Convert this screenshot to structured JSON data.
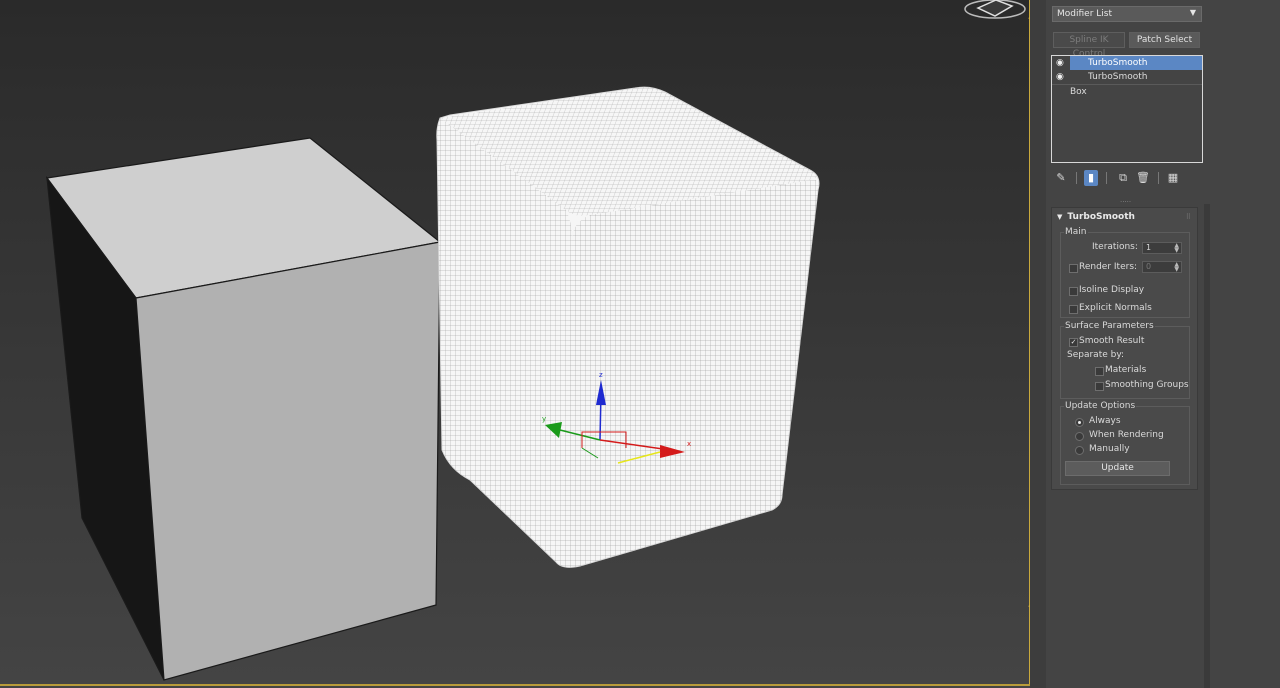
{
  "command_panel": {
    "modifier_list_label": "Modifier List",
    "buttons": {
      "spline_ik": "Spline IK Control",
      "patch_select": "Patch Select"
    },
    "stack": [
      {
        "label": "TurboSmooth",
        "selected": true,
        "visible": true
      },
      {
        "label": "TurboSmooth",
        "selected": false,
        "visible": true
      },
      {
        "label": "Box",
        "selected": false,
        "visible": false
      }
    ],
    "tools": {
      "pin": "pin-icon",
      "show_end": "show-end-result-icon",
      "unique": "make-unique-icon",
      "remove": "trash-icon",
      "configure": "configure-modifier-sets-icon"
    }
  },
  "turbosmooth": {
    "title": "TurboSmooth",
    "main": {
      "title": "Main",
      "iterations_label": "Iterations:",
      "iterations_value": "1",
      "render_iters_label": "Render Iters:",
      "render_iters_value": "0",
      "isoline_label": "Isoline Display",
      "explicit_normals_label": "Explicit Normals"
    },
    "surface": {
      "title": "Surface Parameters",
      "smooth_result_label": "Smooth Result",
      "separate_by_label": "Separate by:",
      "materials_label": "Materials",
      "smoothing_groups_label": "Smoothing Groups"
    },
    "update": {
      "title": "Update Options",
      "always_label": "Always",
      "when_rendering_label": "When Rendering",
      "manually_label": "Manually",
      "update_button": "Update"
    }
  },
  "colors": {
    "accent": "#5b87c4",
    "viewport_border": "#c9a93c"
  },
  "viewport": {
    "gizmo_axes": [
      "x",
      "y",
      "z"
    ]
  }
}
